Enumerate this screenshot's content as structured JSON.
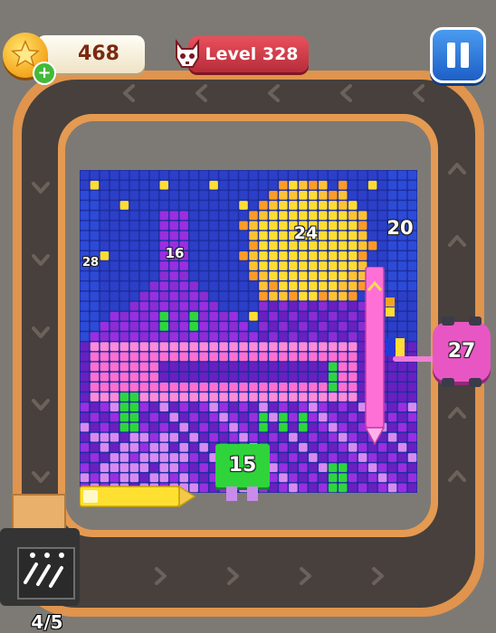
{
  "hud": {
    "coins": "468",
    "level": "Level 328",
    "coin_add": "+"
  },
  "board": {
    "labels": {
      "sky_left": "28",
      "purple_tower": "16",
      "sun": "24",
      "right_edge": "20",
      "green_block": "15"
    }
  },
  "shooter": {
    "count": "27"
  },
  "queue": {
    "counter": "4/5"
  },
  "colors": {
    "board_blue": "#2b3fc8",
    "night_blue": "#1e2ea0",
    "yellow": "#ffdd33",
    "orange": "#ff9a26",
    "purple": "#9a2ee0",
    "violet": "#6a1fc0",
    "pink": "#ff6fd0",
    "lavender": "#d98af0",
    "green": "#2ed63c",
    "track_wood": "#e0944d",
    "belt": "#47403c"
  }
}
